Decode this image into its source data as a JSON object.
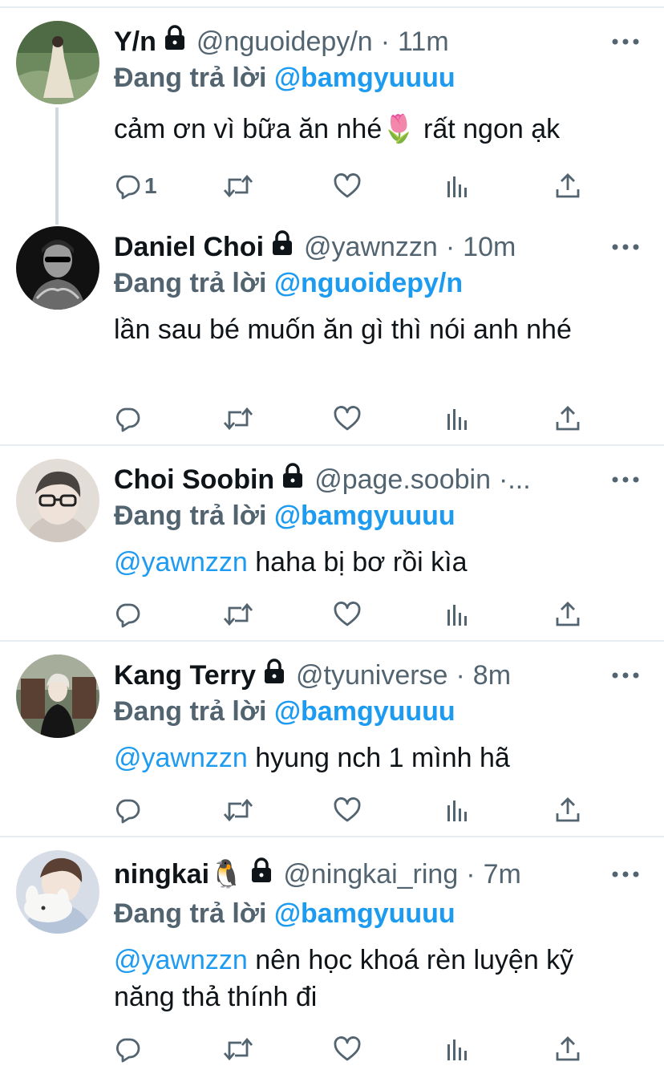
{
  "tweets": [
    {
      "name": "Y/n",
      "handle": "@nguoidepy/n",
      "time": "11m",
      "reply_prefix": "Đang trả lời",
      "reply_to": "@bamgyuuuu",
      "mention": "",
      "text": "cảm ơn vì bữa ăn nhé🌷 rất ngon ạk",
      "reply_count": "1",
      "avatar_colors": [
        "#5e7a55",
        "#c9c2b2"
      ]
    },
    {
      "name": "Daniel Choi",
      "handle": "@yawnzzn",
      "time": "10m",
      "reply_prefix": "Đang trả lời",
      "reply_to": "@nguoidepy/n",
      "mention": "",
      "text": "lần sau bé muốn ăn gì thì nói anh nhé",
      "reply_count": "",
      "avatar_colors": [
        "#1b1b1b",
        "#8a8a8a"
      ]
    },
    {
      "name": "Choi Soobin",
      "handle": "@page.soobin",
      "time": "·...",
      "reply_prefix": "Đang trả lời",
      "reply_to": "@bamgyuuuu",
      "mention": "@yawnzzn",
      "text": "haha bị bơ rồi kìa",
      "reply_count": "",
      "avatar_colors": [
        "#d9d3cf",
        "#6f6862"
      ]
    },
    {
      "name": "Kang Terry",
      "handle": "@tyuniverse",
      "time": "8m",
      "reply_prefix": "Đang trả lời",
      "reply_to": "@bamgyuuuu",
      "mention": "@yawnzzn",
      "text": "hyung nch 1 mình hã",
      "reply_count": "",
      "avatar_colors": [
        "#3c4a3a",
        "#e8e2d6"
      ]
    },
    {
      "name": "ningkai🐧",
      "handle": "@ningkai_ring",
      "time": "7m",
      "reply_prefix": "Đang trả lời",
      "reply_to": "@bamgyuuuu",
      "mention": "@yawnzzn",
      "text": "nên học khoá rèn luyện kỹ năng thả thính đi",
      "reply_count": "",
      "avatar_colors": [
        "#c7cfdc",
        "#f1ede9"
      ]
    }
  ],
  "icons": {
    "reply": "reply-icon",
    "retweet": "retweet-icon",
    "like": "heart-icon",
    "views": "analytics-icon",
    "share": "share-icon",
    "more": "more-icon",
    "lock": "lock-icon"
  },
  "colors": {
    "accent": "#1d9bf0",
    "secondary_text": "#536471",
    "divider": "#e6ecf0"
  }
}
